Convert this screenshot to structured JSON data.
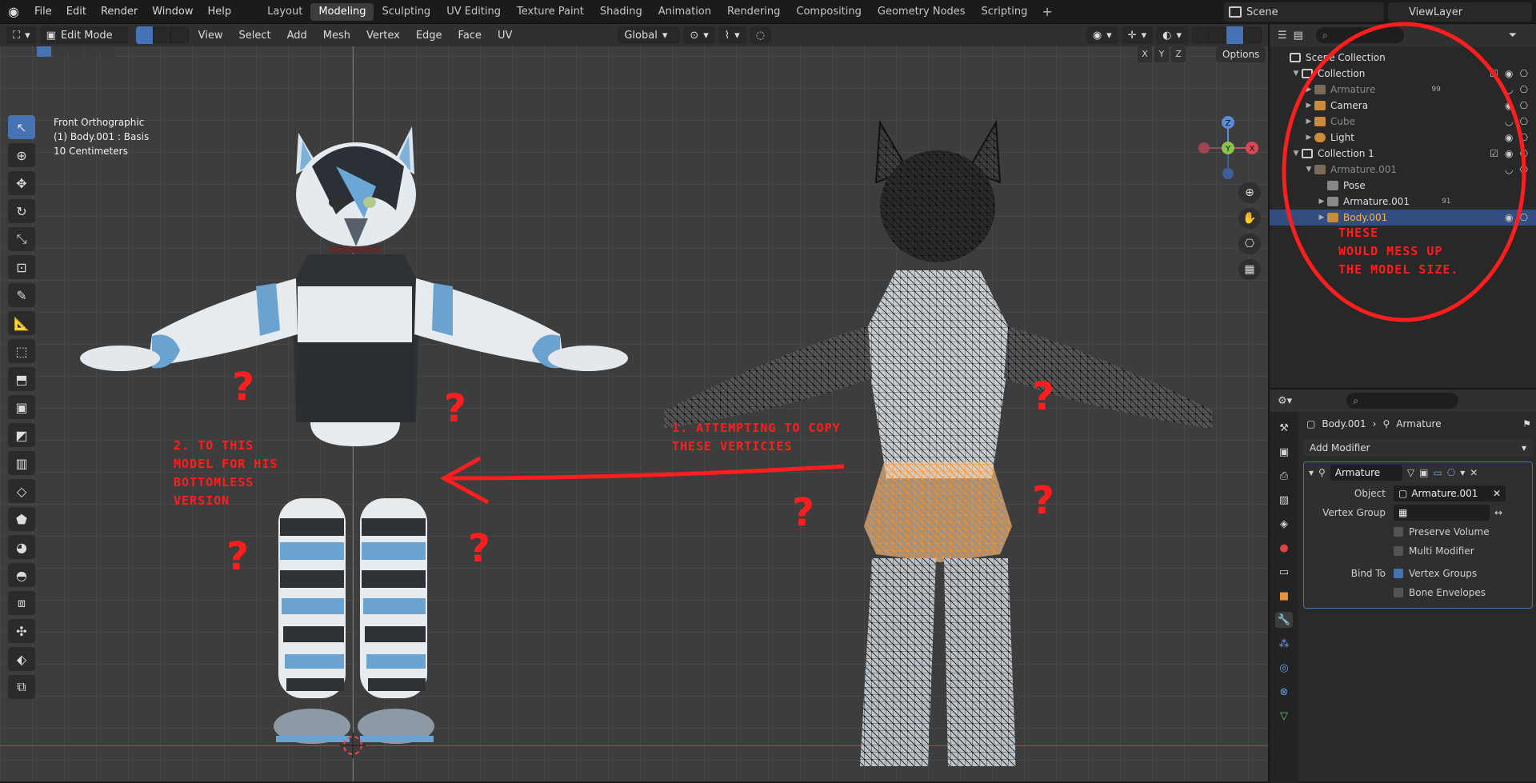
{
  "menu": {
    "items": [
      "File",
      "Edit",
      "Render",
      "Window",
      "Help"
    ]
  },
  "workspaces": {
    "tabs": [
      "Layout",
      "Modeling",
      "Sculpting",
      "UV Editing",
      "Texture Paint",
      "Shading",
      "Animation",
      "Rendering",
      "Compositing",
      "Geometry Nodes",
      "Scripting"
    ],
    "active": "Modeling"
  },
  "scene": {
    "name": "Scene",
    "view_layer": "ViewLayer"
  },
  "viewport_header": {
    "mode": "Edit Mode",
    "menus": [
      "View",
      "Select",
      "Add",
      "Mesh",
      "Vertex",
      "Edge",
      "Face",
      "UV"
    ],
    "orientation": "Global",
    "options_label": "Options",
    "axes": [
      "X",
      "Y",
      "Z"
    ]
  },
  "viewport_info": {
    "view": "Front Orthographic",
    "object": "(1) Body.001 : Basis",
    "scale": "10 Centimeters"
  },
  "gizmo": {
    "z": "Z",
    "y": "Y",
    "x": "X"
  },
  "annotations": {
    "step1": "1. ATTEMPTING TO COPY\nTHESE VERTICIES",
    "step2": "2. TO THIS\nMODEL FOR HIS\nBOTTOMLESS\nVERSION",
    "outliner_note": "THESE\nWOULD MESS UP\nTHE MODEL SIZE.",
    "question": "?",
    "color": "#ff1d1d"
  },
  "outliner": {
    "rows": [
      {
        "label": "Scene Collection",
        "level": 0
      },
      {
        "label": "Collection",
        "level": 1
      },
      {
        "label": "Armature",
        "level": 2,
        "suffix": "99"
      },
      {
        "label": "Camera",
        "level": 2
      },
      {
        "label": "Cube",
        "level": 2
      },
      {
        "label": "Light",
        "level": 2
      },
      {
        "label": "Collection 1",
        "level": 1
      },
      {
        "label": "Armature.001",
        "level": 2
      },
      {
        "label": "Pose",
        "level": 3
      },
      {
        "label": "Armature.001",
        "level": 3,
        "suffix": "91"
      },
      {
        "label": "Body.001",
        "level": 3
      }
    ]
  },
  "properties": {
    "breadcrumb_object": "Body.001",
    "breadcrumb_modifier": "Armature",
    "add_modifier": "Add Modifier",
    "modifier_name": "Armature",
    "object_label": "Object",
    "object_value": "Armature.001",
    "vertex_group_label": "Vertex Group",
    "vertex_group_value": "",
    "preserve_volume": "Preserve Volume",
    "multi_modifier": "Multi Modifier",
    "bind_to_label": "Bind To",
    "vertex_groups": "Vertex Groups",
    "bone_envelopes": "Bone Envelopes"
  }
}
